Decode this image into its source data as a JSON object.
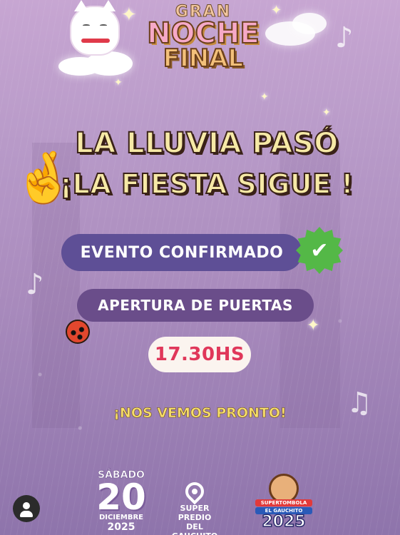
{
  "logo": {
    "line1": "GRAN",
    "line2": "NOCHE",
    "line3": "FINAL"
  },
  "headline": {
    "line1": "LA LLUVIA PASÓ",
    "line2": "¡LA FIESTA SIGUE !"
  },
  "event_status": "EVENTO CONFIRMADO",
  "doors_label": "APERTURA DE PUERTAS",
  "doors_time": "17.30HS",
  "closing": "¡NOS VEMOS PRONTO!",
  "date": {
    "weekday": "SÁBADO",
    "day": "20",
    "month": "DICIEMBRE",
    "year": "2025"
  },
  "venue": {
    "line1": "SUPER PREDIO",
    "line2": "DEL GAUCHITO"
  },
  "sponsor": {
    "tag": "SUPERTOMBOLA",
    "name": "EL GAUCHITO",
    "year": "2025"
  },
  "icons": {
    "check": "check-badge-icon",
    "pin": "location-pin-icon",
    "avatar": "user-avatar-icon"
  },
  "colors": {
    "background": "#b99bc9",
    "headline_text": "#f6e9a6",
    "pill_primary": "#5e4f96",
    "pill_secondary": "#6a4d8a",
    "time_text": "#e0375a",
    "closing_text": "#f7df6a",
    "confirm_green": "#54b847"
  }
}
